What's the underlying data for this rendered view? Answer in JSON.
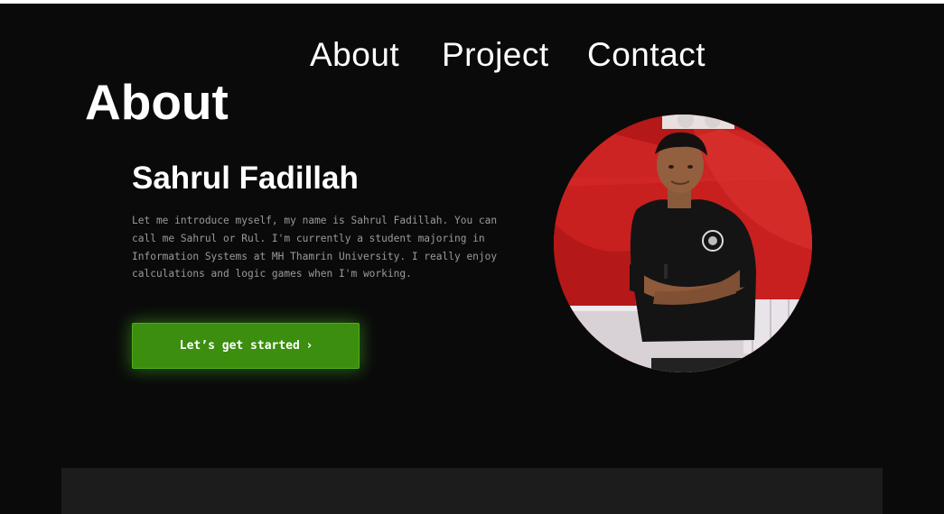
{
  "nav": {
    "items": [
      {
        "label": "About"
      },
      {
        "label": "Project"
      },
      {
        "label": "Contact"
      }
    ]
  },
  "about": {
    "title": "About",
    "name": "Sahrul Fadillah",
    "bio": "Let me introduce myself, my name is Sahrul Fadillah. You can call me Sahrul or Rul. I'm currently a student majoring in Information Systems at MH Thamrin University. I really enjoy calculations and logic games when I'm working.",
    "cta_label": "Let’s get started",
    "cta_icon": "chevron-right-icon"
  },
  "photo": {
    "icon": "profile-photo",
    "background_color": "#c81f1f"
  },
  "colors": {
    "background": "#0a0a0a",
    "accent": "#3b8e0e",
    "text_muted": "#9a9a9a",
    "panel": "#1c1c1c"
  }
}
